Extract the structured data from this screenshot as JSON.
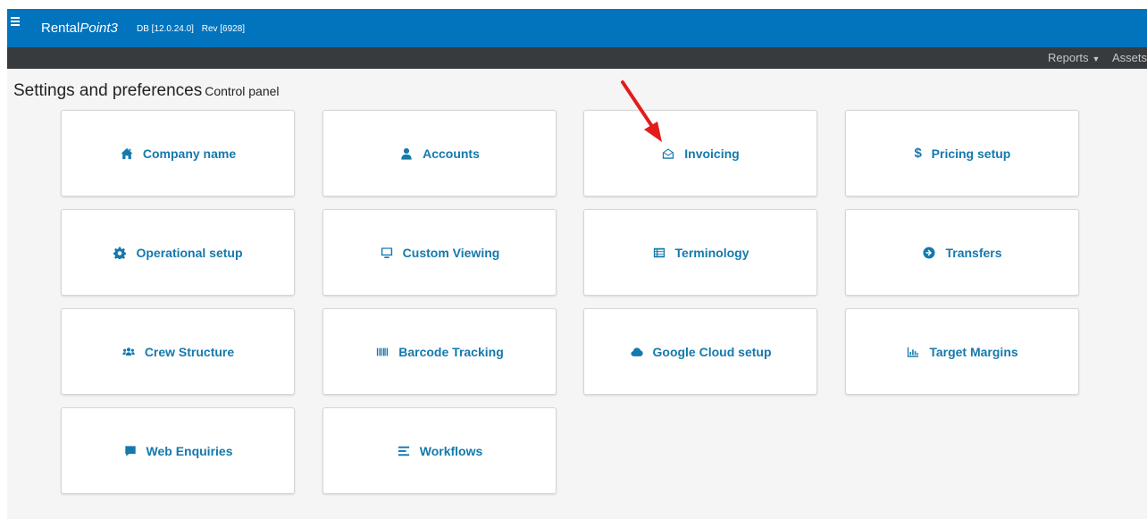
{
  "header": {
    "brand_prefix": "Rental",
    "brand_italic": "Point3",
    "db_version": "DB [12.0.24.0]",
    "rev": "Rev [6928]"
  },
  "nav": {
    "reports": "Reports",
    "assets": "Assets"
  },
  "page": {
    "title": "Settings and preferences",
    "subtitle": "Control panel"
  },
  "tiles": [
    {
      "label": "Company name",
      "icon": "home-icon"
    },
    {
      "label": "Accounts",
      "icon": "user-icon"
    },
    {
      "label": "Invoicing",
      "icon": "envelope-open-icon"
    },
    {
      "label": "Pricing setup",
      "icon": "dollar-icon"
    },
    {
      "label": "Operational setup",
      "icon": "gear-icon"
    },
    {
      "label": "Custom Viewing",
      "icon": "monitor-icon"
    },
    {
      "label": "Terminology",
      "icon": "list-icon"
    },
    {
      "label": "Transfers",
      "icon": "arrow-circle-right-icon"
    },
    {
      "label": "Crew Structure",
      "icon": "users-icon"
    },
    {
      "label": "Barcode Tracking",
      "icon": "barcode-icon"
    },
    {
      "label": "Google Cloud setup",
      "icon": "cloud-icon"
    },
    {
      "label": "Target Margins",
      "icon": "bar-chart-icon"
    },
    {
      "label": "Web Enquiries",
      "icon": "comment-icon"
    },
    {
      "label": "Workflows",
      "icon": "align-icon"
    }
  ],
  "colors": {
    "header_bg": "#0274be",
    "subbar_bg": "#373b3e",
    "tile_text": "#1479ad",
    "annotation_arrow": "#e31c1c"
  }
}
